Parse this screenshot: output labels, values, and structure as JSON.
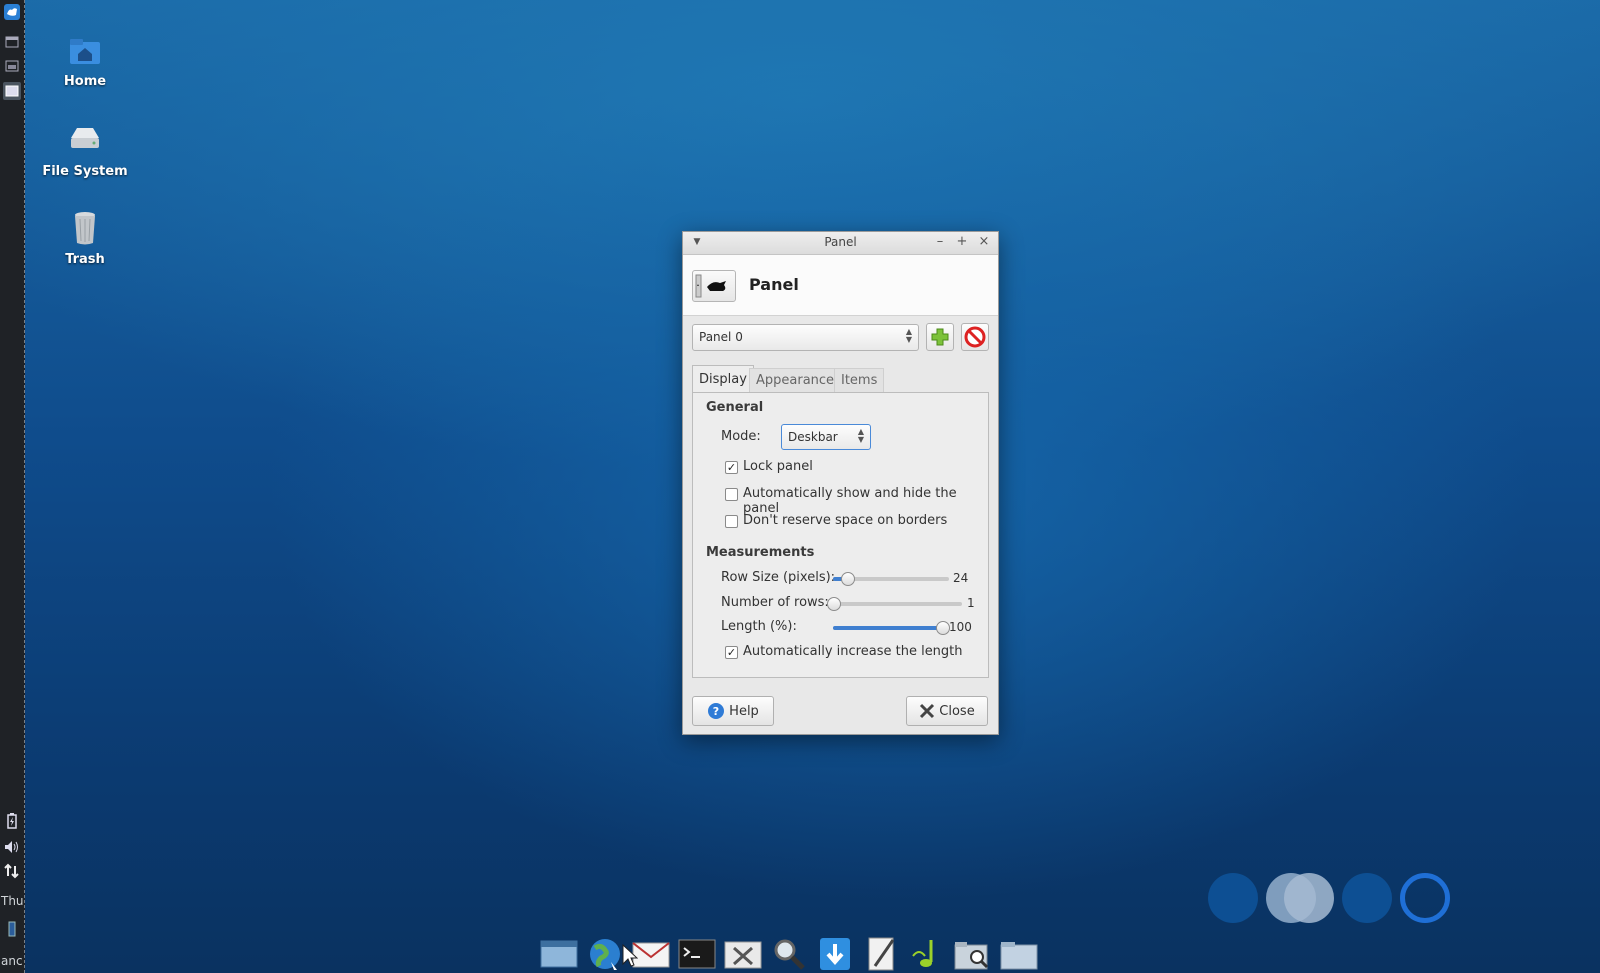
{
  "side_panel": {
    "day_label": "Thu",
    "bottom_label": "anc"
  },
  "desktop": {
    "icons": [
      {
        "label": "Home"
      },
      {
        "label": "File System"
      },
      {
        "label": "Trash"
      }
    ]
  },
  "window": {
    "title": "Panel",
    "header_title": "Panel",
    "panel_select": "Panel 0",
    "tabs": [
      "Display",
      "Appearance",
      "Items"
    ],
    "active_tab": "Display",
    "general": {
      "heading": "General",
      "mode_label": "Mode:",
      "mode_value": "Deskbar",
      "lock_panel": {
        "label": "Lock panel",
        "checked": true
      },
      "auto_hide": {
        "label": "Automatically show and hide the panel",
        "checked": false
      },
      "no_reserve": {
        "label": "Don't reserve space on borders",
        "checked": false
      }
    },
    "measurements": {
      "heading": "Measurements",
      "row_size": {
        "label": "Row Size (pixels):",
        "value": "24",
        "level": 0.12
      },
      "num_rows": {
        "label": "Number of rows:",
        "value": "1",
        "level": 0.0
      },
      "length": {
        "label": "Length (%):",
        "value": "100",
        "level": 1.0
      },
      "auto_length": {
        "label": "Automatically increase the length",
        "checked": true
      }
    },
    "help_label": "Help",
    "close_label": "Close"
  },
  "dock": {
    "items": [
      "desktop-icon",
      "web-browser-icon",
      "mail-icon",
      "terminal-icon",
      "settings-icon",
      "search-icon",
      "download-icon",
      "text-editor-icon",
      "music-player-icon",
      "file-search-icon",
      "folder-icon"
    ]
  },
  "colors": {
    "accent": "#3f7fd0",
    "workspace_active": "#1f6fd6"
  }
}
